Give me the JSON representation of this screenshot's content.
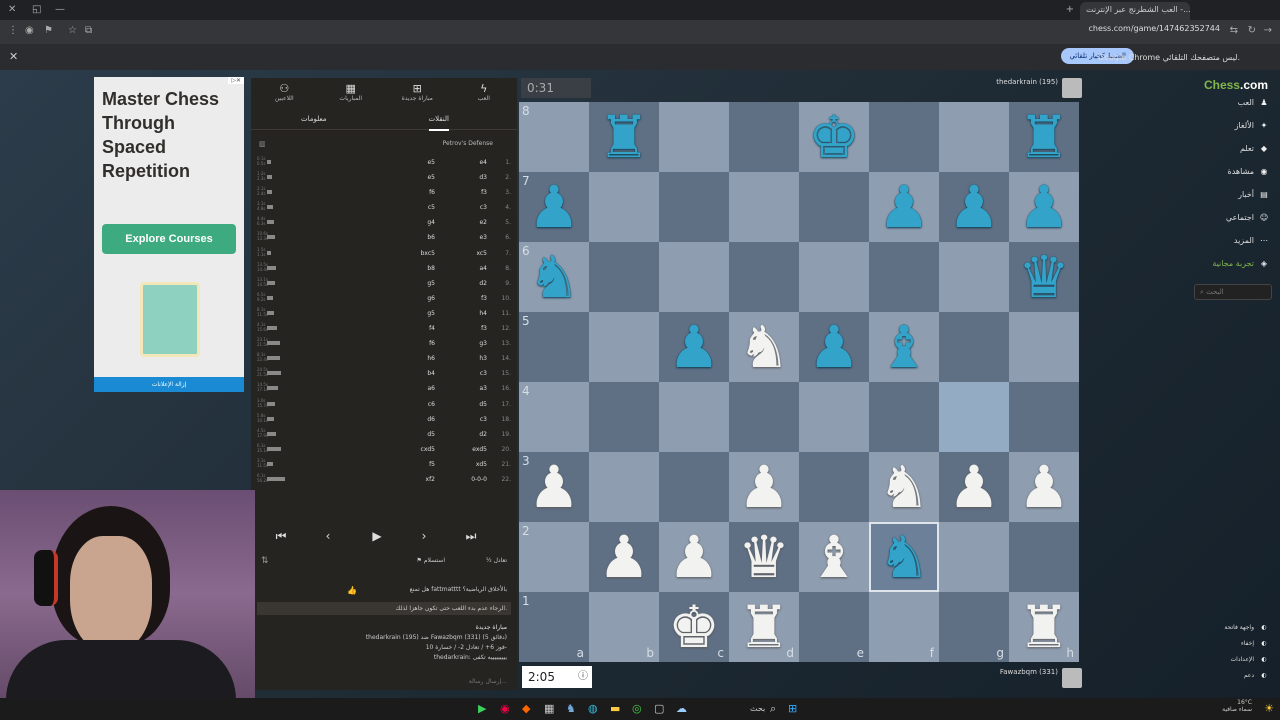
{
  "browser": {
    "tab_title": "العب الشطرنج عبر الإنترنت -...",
    "url": "chess.com/game/147462352744",
    "info_message": "Google Chrome ليس متصفحك التلقائي.",
    "info_button": "الضبط كخيار تلقائي"
  },
  "ad": {
    "title": "Master Chess Through Spaced Repetition",
    "cta": "Explore Courses",
    "remove": "إزالة الإعلانات"
  },
  "panel": {
    "nav": [
      {
        "label": "العب",
        "icon": "bolt-icon"
      },
      {
        "label": "مباراة جديدة",
        "icon": "plus-icon"
      },
      {
        "label": "المباريات",
        "icon": "grid-icon"
      },
      {
        "label": "اللاعبين",
        "icon": "players-icon"
      }
    ],
    "tab_moves": "النقلات",
    "tab_info": "معلومات",
    "opening": "Petrov's Defense",
    "moves": [
      {
        "n": "1.",
        "w": "e4",
        "b": "e5",
        "t1": "0.1s",
        "t2": "0.5s",
        "bar": 4
      },
      {
        "n": "2.",
        "w": "d3",
        "b": "e5",
        "t1": "1.2s",
        "t2": "2.3s",
        "bar": 6
      },
      {
        "n": "3.",
        "w": "f3",
        "b": "f6",
        "t1": "2.1s",
        "t2": "2.4s",
        "bar": 5
      },
      {
        "n": "4.",
        "w": "c3",
        "b": "c5",
        "t1": "3.1s",
        "t2": "4.8s",
        "bar": 7
      },
      {
        "n": "5.",
        "w": "e2",
        "b": "g4",
        "t1": "4.4s",
        "t2": "6.3s",
        "bar": 8
      },
      {
        "n": "6.",
        "w": "e3",
        "b": "b6",
        "t1": "10.6s",
        "t2": "13.3s",
        "bar": 9
      },
      {
        "n": "7.",
        "w": "xc5",
        "b": "bxc5",
        "t1": "1.5s",
        "t2": "1.1s",
        "bar": 4
      },
      {
        "n": "8.",
        "w": "a4",
        "b": "b8",
        "t1": "13.5s",
        "t2": "14.4s",
        "bar": 10
      },
      {
        "n": "9.",
        "w": "d2",
        "b": "g5",
        "t1": "13.1s",
        "t2": "14.5s",
        "bar": 9
      },
      {
        "n": "10.",
        "w": "f3",
        "b": "g6",
        "t1": "6.5s",
        "t2": "9.2s",
        "bar": 7
      },
      {
        "n": "11.",
        "w": "h4",
        "b": "g5",
        "t1": "8.1s",
        "t2": "11.5s",
        "bar": 8
      },
      {
        "n": "12.",
        "w": "f3",
        "b": "f4",
        "t1": "4.1s",
        "t2": "15.6s",
        "bar": 11
      },
      {
        "n": "13.",
        "w": "g3",
        "b": "f6",
        "t1": "23.1s",
        "t2": "21.5s",
        "bar": 14
      },
      {
        "n": "14.",
        "w": "h3",
        "b": "h6",
        "t1": "8.1s",
        "t2": "22.4s",
        "bar": 14
      },
      {
        "n": "15.",
        "w": "c3",
        "b": "b4",
        "t1": "24.5s",
        "t2": "21.5s",
        "bar": 15
      },
      {
        "n": "16.",
        "w": "a3",
        "b": "a6",
        "t1": "14.5s",
        "t2": "17.1s",
        "bar": 12
      },
      {
        "n": "17.",
        "w": "d5",
        "b": "c6",
        "t1": "3.0s",
        "t2": "15.7s",
        "bar": 9
      },
      {
        "n": "18.",
        "w": "c3",
        "b": "d6",
        "t1": "5.8s",
        "t2": "10.1s",
        "bar": 8
      },
      {
        "n": "19.",
        "w": "d2",
        "b": "d5",
        "t1": "4.5s",
        "t2": "17.9s",
        "bar": 10
      },
      {
        "n": "20.",
        "w": "exd5",
        "b": "cxd5",
        "t1": "6.1s",
        "t2": "35.1s",
        "bar": 16
      },
      {
        "n": "21.",
        "w": "xd5",
        "b": "f5",
        "t1": "3.1s",
        "t2": "11.5s",
        "bar": 7
      },
      {
        "n": "22.",
        "w": "0-0-0",
        "b": "xf2",
        "t1": "6.1s",
        "t2": "56.2s",
        "bar": 20
      }
    ],
    "draw": "تعادل",
    "resign": "استسلام",
    "chat": [
      "هل تمنع fattmatttt بالأخلاق الرياضية؟",
      "الرجاء عدم بدء اللعب حتى تكون جاهزا لذلك.",
      "مباراة جديدة",
      "thedarkrain (195) ضد Fawazbqm (331) (5 دقائق)",
      "فوز 6+ / تعادل 2- / خسارة 10-",
      "thedarkrain: يييييييييه تكفى"
    ],
    "chat_placeholder": "إرسال رسالة..."
  },
  "game": {
    "top_clock": "0:31",
    "bottom_clock": "2:05",
    "top_player": "thedarkrain (195)",
    "bottom_player": "Fawazbqm (331)",
    "ranks": [
      "8",
      "7",
      "6",
      "5",
      "4",
      "3",
      "2",
      "1"
    ],
    "files": [
      "a",
      "b",
      "c",
      "d",
      "e",
      "f",
      "g",
      "h"
    ],
    "pieces": [
      {
        "sq": "b8",
        "p": "♜",
        "c": "bl"
      },
      {
        "sq": "e8",
        "p": "♚",
        "c": "bl"
      },
      {
        "sq": "h8",
        "p": "♜",
        "c": "bl"
      },
      {
        "sq": "a7",
        "p": "♟",
        "c": "bl"
      },
      {
        "sq": "f7",
        "p": "♟",
        "c": "bl"
      },
      {
        "sq": "g7",
        "p": "♟",
        "c": "bl"
      },
      {
        "sq": "h7",
        "p": "♟",
        "c": "bl"
      },
      {
        "sq": "a6",
        "p": "♞",
        "c": "bl"
      },
      {
        "sq": "h6",
        "p": "♛",
        "c": "bl"
      },
      {
        "sq": "c5",
        "p": "♟",
        "c": "bl"
      },
      {
        "sq": "d5",
        "p": "♞",
        "c": "wh"
      },
      {
        "sq": "e5",
        "p": "♟",
        "c": "bl"
      },
      {
        "sq": "f5",
        "p": "♝",
        "c": "bl"
      },
      {
        "sq": "a3",
        "p": "♟",
        "c": "wh"
      },
      {
        "sq": "d3",
        "p": "♟",
        "c": "wh"
      },
      {
        "sq": "f3",
        "p": "♞",
        "c": "wh"
      },
      {
        "sq": "g3",
        "p": "♟",
        "c": "wh"
      },
      {
        "sq": "h3",
        "p": "♟",
        "c": "wh"
      },
      {
        "sq": "b2",
        "p": "♟",
        "c": "wh"
      },
      {
        "sq": "c2",
        "p": "♟",
        "c": "wh"
      },
      {
        "sq": "d2",
        "p": "♛",
        "c": "wh"
      },
      {
        "sq": "e2",
        "p": "♝",
        "c": "wh"
      },
      {
        "sq": "f2",
        "p": "♞",
        "c": "bl"
      },
      {
        "sq": "c1",
        "p": "♚",
        "c": "wh"
      },
      {
        "sq": "d1",
        "p": "♜",
        "c": "wh"
      },
      {
        "sq": "h1",
        "p": "♜",
        "c": "wh"
      }
    ],
    "highlight": "g4",
    "selected": "f2"
  },
  "sidenav": {
    "logo_a": "Chess",
    "logo_b": ".com",
    "items": [
      {
        "label": "العب",
        "icon": "♟"
      },
      {
        "label": "الألغاز",
        "icon": "✦"
      },
      {
        "label": "تعلم",
        "icon": "◆"
      },
      {
        "label": "مشاهدة",
        "icon": "◉"
      },
      {
        "label": "أخبار",
        "icon": "▤"
      },
      {
        "label": "اجتماعي",
        "icon": "☺"
      },
      {
        "label": "المزيد",
        "icon": "⋯"
      },
      {
        "label": "تجربة مجانية",
        "icon": "◈"
      }
    ],
    "search_placeholder": "البحث",
    "bottom": [
      "واجهة فاتحة",
      "إخفاء",
      "الإعدادات",
      "دعم"
    ]
  },
  "taskbar": {
    "search": "بحث",
    "temp": "16°C",
    "weather": "سماء صافية"
  }
}
